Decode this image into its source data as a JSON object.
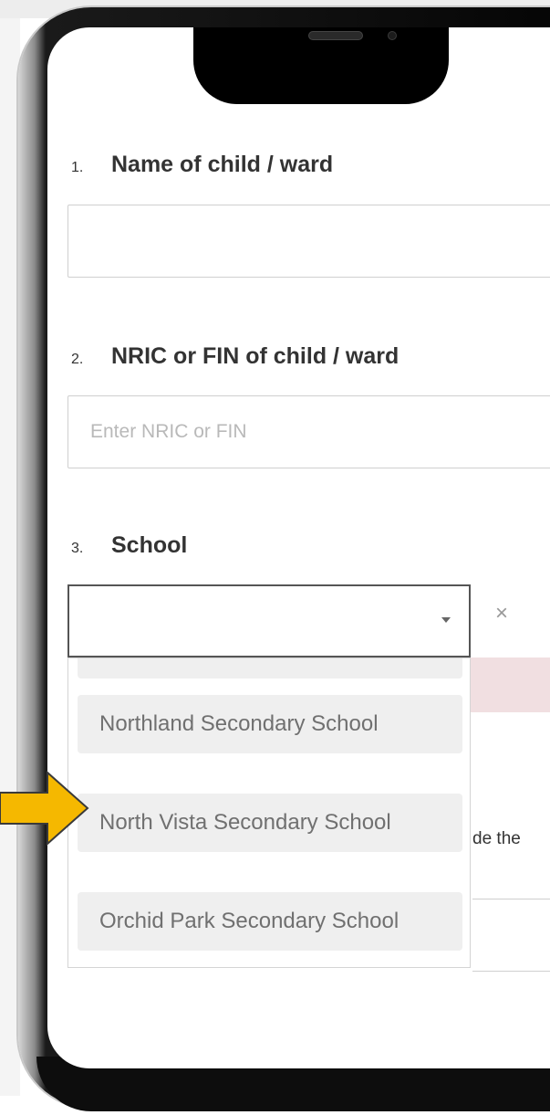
{
  "form": {
    "q1": {
      "number": "1.",
      "label": "Name of child / ward",
      "value": "",
      "placeholder": ""
    },
    "q2": {
      "number": "2.",
      "label": "NRIC or FIN of child / ward",
      "value": "",
      "placeholder": "Enter NRIC or FIN"
    },
    "q3": {
      "number": "3.",
      "label": "School",
      "selected": "",
      "clear_glyph": "×",
      "options": [
        {
          "label": ""
        },
        {
          "label": "Northland Secondary School"
        },
        {
          "label": "North Vista Secondary School"
        },
        {
          "label": "Orchid Park Secondary School"
        }
      ]
    }
  },
  "background_text": "de the",
  "colors": {
    "arrow_fill": "#f5b800",
    "arrow_outline": "#3a3a3a",
    "error_tint": "#f1dfe1"
  },
  "icons": {
    "dropdown": "caret-down-icon",
    "clear": "close-icon",
    "pointer": "arrow-right-icon"
  }
}
